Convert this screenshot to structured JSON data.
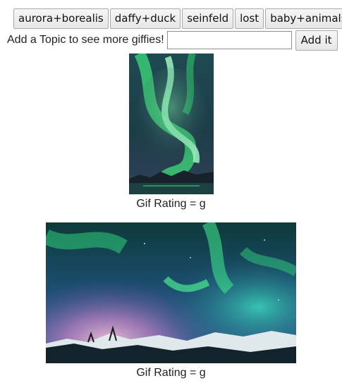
{
  "topics": [
    {
      "label": "aurora+borealis"
    },
    {
      "label": "daffy+duck"
    },
    {
      "label": "seinfeld"
    },
    {
      "label": "lost"
    },
    {
      "label": "baby+animals"
    }
  ],
  "form": {
    "prompt": "Add a Topic to see more giffies!",
    "input_value": "",
    "input_placeholder": "",
    "submit_label": "Add it"
  },
  "gifs": [
    {
      "rating_text": "Gif Rating = g"
    },
    {
      "rating_text": "Gif Rating = g"
    }
  ],
  "colors": {
    "aurora_green": "#3dd67a",
    "night_sky": "#0e2a38",
    "snow": "#dfe9ec"
  }
}
